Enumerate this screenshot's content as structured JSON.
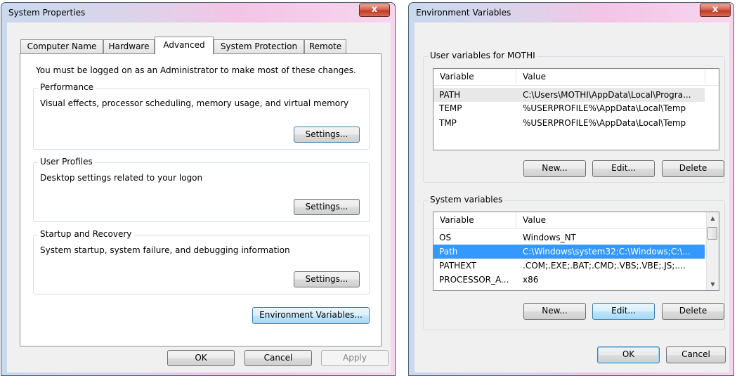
{
  "system_properties": {
    "title": "System Properties",
    "close_glyph": "x",
    "tabs": [
      {
        "label": "Computer Name"
      },
      {
        "label": "Hardware"
      },
      {
        "label": "Advanced"
      },
      {
        "label": "System Protection"
      },
      {
        "label": "Remote"
      }
    ],
    "admin_notice": "You must be logged on as an Administrator to make most of these changes.",
    "performance": {
      "title": "Performance",
      "description": "Visual effects, processor scheduling, memory usage, and virtual memory",
      "button": "Settings..."
    },
    "user_profiles": {
      "title": "User Profiles",
      "description": "Desktop settings related to your logon",
      "button": "Settings..."
    },
    "startup_recovery": {
      "title": "Startup and Recovery",
      "description": "System startup, system failure, and debugging information",
      "button": "Settings..."
    },
    "env_button": "Environment Variables...",
    "ok": "OK",
    "cancel": "Cancel",
    "apply": "Apply"
  },
  "environment_variables": {
    "title": "Environment Variables",
    "close_glyph": "x",
    "user_group_title": "User variables for MOTHI",
    "columns": {
      "variable": "Variable",
      "value": "Value"
    },
    "user_vars": [
      {
        "name": "PATH",
        "value": "C:\\Users\\MOTHI\\AppData\\Local\\Progra..."
      },
      {
        "name": "TEMP",
        "value": "%USERPROFILE%\\AppData\\Local\\Temp"
      },
      {
        "name": "TMP",
        "value": "%USERPROFILE%\\AppData\\Local\\Temp"
      }
    ],
    "user_buttons": {
      "new": "New...",
      "edit": "Edit...",
      "delete": "Delete"
    },
    "system_group_title": "System variables",
    "system_vars": [
      {
        "name": "OS",
        "value": "Windows_NT"
      },
      {
        "name": "Path",
        "value": "C:\\Windows\\system32;C:\\Windows;C:\\..."
      },
      {
        "name": "PATHEXT",
        "value": ".COM;.EXE;.BAT;.CMD;.VBS;.VBE;.JS;...."
      },
      {
        "name": "PROCESSOR_A...",
        "value": "x86"
      }
    ],
    "system_selected": "Path",
    "system_buttons": {
      "new": "New...",
      "edit": "Edit...",
      "delete": "Delete"
    },
    "ok": "OK",
    "cancel": "Cancel"
  }
}
